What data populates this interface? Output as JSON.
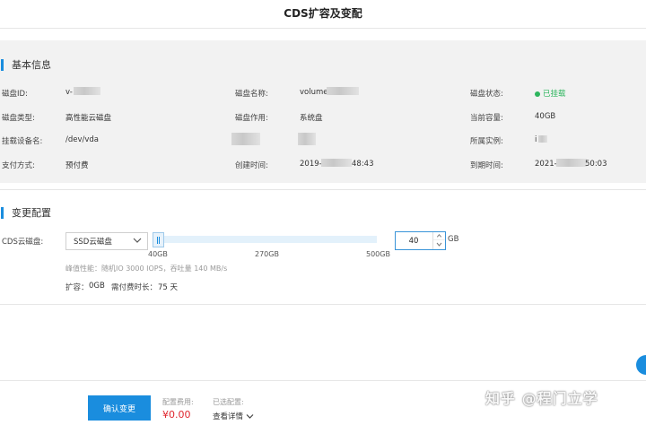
{
  "header": {
    "title": "CDS扩容及变配"
  },
  "basic_info": {
    "section_title": "基本信息",
    "fields": {
      "disk_id": {
        "label": "磁盘ID:",
        "value": "v-"
      },
      "disk_name": {
        "label": "磁盘名称:",
        "value": "volume"
      },
      "disk_status": {
        "label": "磁盘状态:",
        "value": "已挂载"
      },
      "disk_type": {
        "label": "磁盘类型:",
        "value": "高性能云磁盘"
      },
      "disk_role": {
        "label": "磁盘作用:",
        "value": "系统盘"
      },
      "current_capacity": {
        "label": "当前容量:",
        "value": "40GB"
      },
      "mount_device": {
        "label": "挂载设备名:",
        "value": "/dev/vda"
      },
      "instance": {
        "label": "所属实例:",
        "value": "i"
      },
      "payment": {
        "label": "支付方式:",
        "value": "预付费"
      },
      "created_at": {
        "label": "创建时间:",
        "value_prefix": "2019-",
        "value_suffix": "48:43"
      },
      "expires_at": {
        "label": "到期时间:",
        "value_prefix": "2021-",
        "value_suffix": "50:03"
      }
    },
    "status_color": "#2db55d"
  },
  "change_config": {
    "section_title": "变更配置",
    "cds_label": "CDS云磁盘:",
    "select_value": "SSD云磁盘",
    "slider": {
      "ticks": [
        "40GB",
        "270GB",
        "500GB"
      ],
      "min": 40,
      "max": 500,
      "value": 40
    },
    "size_input": {
      "value": "40",
      "unit": "GB"
    },
    "performance": "峰值性能：随机IO 3000 IOPS，吞吐量 140 MB/s",
    "expand_label": "扩容：",
    "expand_value": "0GB",
    "duration_label": "需付费时长：",
    "duration_value": "75 天"
  },
  "footer": {
    "confirm_label": "确认变更",
    "fee_label": "配置费用:",
    "price": "¥0.00",
    "selected_label": "已选配置:",
    "detail_label": "查看详情"
  },
  "watermark": "知乎 @程门立学",
  "colors": {
    "accent": "#1a8dde",
    "price": "#e0272f"
  }
}
